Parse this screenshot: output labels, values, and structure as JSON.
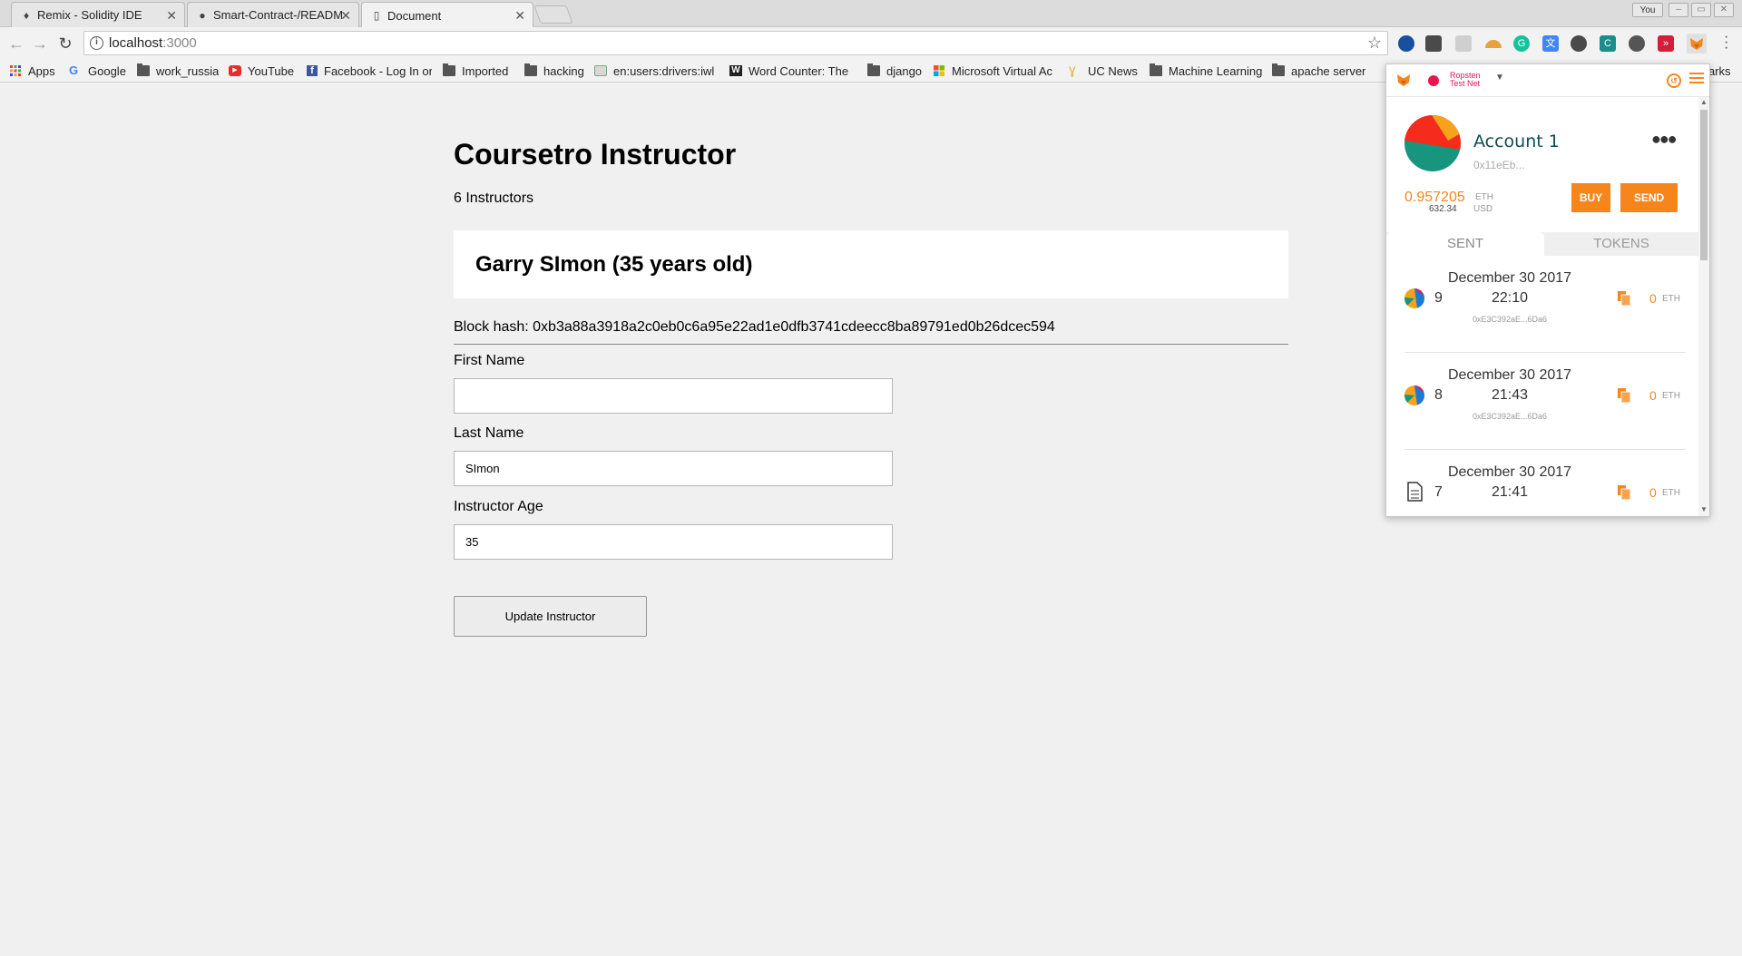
{
  "browser": {
    "tabs": [
      {
        "title": "Remix - Solidity IDE",
        "icon": "ethereum-icon"
      },
      {
        "title": "Smart-Contract-/READM",
        "icon": "github-icon"
      },
      {
        "title": "Document",
        "icon": "document-icon"
      }
    ],
    "profile_label": "You",
    "url_host": "localhost",
    "url_port": ":3000",
    "bookmarks": [
      {
        "label": "Apps",
        "icon": "apps-grid-icon"
      },
      {
        "label": "Google",
        "icon": "google-icon"
      },
      {
        "label": "work_russia",
        "icon": "folder-icon"
      },
      {
        "label": "YouTube",
        "icon": "youtube-icon"
      },
      {
        "label": "Facebook - Log In or",
        "icon": "facebook-icon"
      },
      {
        "label": "Imported",
        "icon": "folder-icon"
      },
      {
        "label": "hacking",
        "icon": "folder-icon"
      },
      {
        "label": "en:users:drivers:iwl",
        "icon": "wiki-icon"
      },
      {
        "label": "Word Counter: The",
        "icon": "w-icon"
      },
      {
        "label": "django",
        "icon": "folder-icon"
      },
      {
        "label": "Microsoft Virtual Ac",
        "icon": "microsoft-icon"
      },
      {
        "label": "UC News",
        "icon": "uc-icon"
      },
      {
        "label": "Machine Learning",
        "icon": "folder-icon"
      },
      {
        "label": "apache server",
        "icon": "folder-icon"
      }
    ],
    "bookmarks_overflow_label": "arks"
  },
  "page": {
    "title": "Coursetro Instructor",
    "instructor_count": "6 Instructors",
    "card_name": "Garry SImon (35 years old)",
    "block_hash": "Block hash: 0xb3a88a3918a2c0eb0c6a95e22ad1e0dfb3741cdeecc8ba89791ed0b26dcec594",
    "fields": {
      "first_name_label": "First Name",
      "first_name_value": "",
      "last_name_label": "Last Name",
      "last_name_value": "SImon",
      "age_label": "Instructor Age",
      "age_value": "35"
    },
    "update_button": "Update Instructor"
  },
  "metamask": {
    "network_line1": "Ropsten",
    "network_line2": "Test Net",
    "account_name": "Account 1",
    "account_address": "0x11eEb...",
    "balance_eth": "0.957205",
    "balance_eth_unit": "ETH",
    "balance_usd": "632.34",
    "balance_usd_unit": "USD",
    "buy_label": "BUY",
    "send_label": "SEND",
    "tab_sent": "SENT",
    "tab_tokens": "TOKENS",
    "transactions": [
      {
        "nonce": "9",
        "date": "December 30 2017",
        "time": "22:10",
        "to": "0xE3C392aE...6Da6",
        "amount": "0",
        "unit": "ETH",
        "icon": "identicon-icon"
      },
      {
        "nonce": "8",
        "date": "December 30 2017",
        "time": "21:43",
        "to": "0xE3C392aE...6Da6",
        "amount": "0",
        "unit": "ETH",
        "icon": "identicon-icon"
      },
      {
        "nonce": "7",
        "date": "December 30 2017",
        "time": "21:41",
        "to": "",
        "amount": "0",
        "unit": "ETH",
        "icon": "contract-document-icon"
      }
    ],
    "colors": {
      "accent": "#f6851b",
      "network": "#e91550",
      "account": "#0f4d4f"
    }
  }
}
